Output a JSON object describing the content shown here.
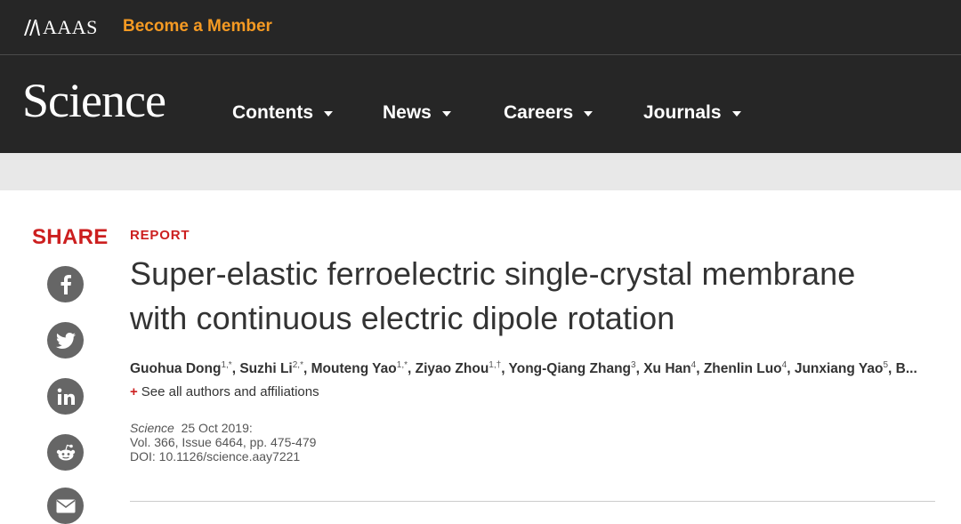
{
  "header": {
    "aaas_logo_text": "AAAS",
    "become_member": "Become a Member"
  },
  "nav": {
    "logo": "Science",
    "items": [
      {
        "label": "Contents"
      },
      {
        "label": "News"
      },
      {
        "label": "Careers"
      },
      {
        "label": "Journals"
      }
    ]
  },
  "share": {
    "label": "SHARE",
    "icons": [
      "facebook-icon",
      "twitter-icon",
      "linkedin-icon",
      "reddit-icon",
      "email-icon"
    ]
  },
  "article": {
    "kind": "REPORT",
    "title_line1": "Super-elastic ferroelectric single-crystal membrane",
    "title_line2": "with continuous electric dipole rotation",
    "authors": [
      {
        "name": "Guohua Dong",
        "sup": "1,*"
      },
      {
        "name": "Suzhi Li",
        "sup": "2,*"
      },
      {
        "name": "Mouteng Yao",
        "sup": "1,*"
      },
      {
        "name": "Ziyao Zhou",
        "sup": "1,†"
      },
      {
        "name": "Yong-Qiang Zhang",
        "sup": "3"
      },
      {
        "name": "Xu Han",
        "sup": "4"
      },
      {
        "name": "Zhenlin Luo",
        "sup": "4"
      },
      {
        "name": "Junxiang Yao",
        "sup": "5"
      },
      {
        "name": "B...",
        "sup": ""
      }
    ],
    "see_all": "See all authors and affiliations",
    "citation": {
      "journal": "Science",
      "date": "25 Oct 2019:",
      "volume": "Vol. 366, Issue 6464, pp. 475-479",
      "doi": "DOI: 10.1126/science.aay7221"
    }
  },
  "colors": {
    "header_bg": "#262626",
    "accent_orange": "#f59a23",
    "accent_red": "#cc1f1f",
    "icon_gray": "#666666"
  }
}
